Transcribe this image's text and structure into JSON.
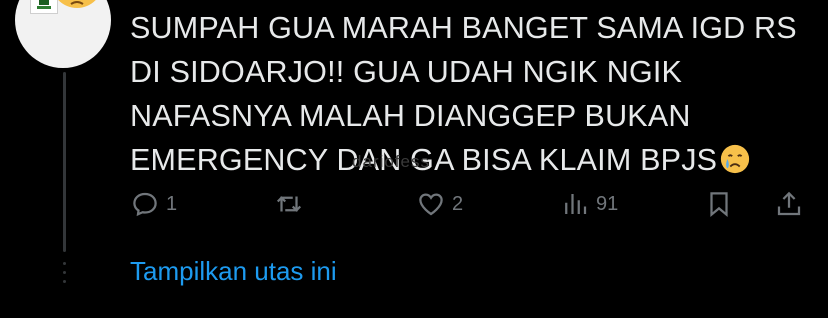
{
  "tweet": {
    "line1": "SUMPAH GUA MARAH BANGET SAMA IGD RS",
    "line2": "DI SIDOARJO!! GUA UDAH NGIK NGIK",
    "line3": "NAFASNYA MALAH DIANGGEP BUKAN",
    "line4": "EMERGENCY DAN GA BISA KLAIM BPJS",
    "emoji": "crying-face-emoji",
    "watermark": "dariofess"
  },
  "actions": {
    "reply_count": "1",
    "retweet_count": "",
    "like_count": "2",
    "views_count": "91"
  },
  "thread": {
    "show_label": "Tampilkan utas ini"
  },
  "colors": {
    "background": "#000000",
    "text": "#e7e9ea",
    "muted": "#71767b",
    "link": "#1d9bf0"
  },
  "icons": [
    "reply-icon",
    "retweet-icon",
    "like-icon",
    "views-icon",
    "bookmark-icon",
    "share-icon"
  ]
}
